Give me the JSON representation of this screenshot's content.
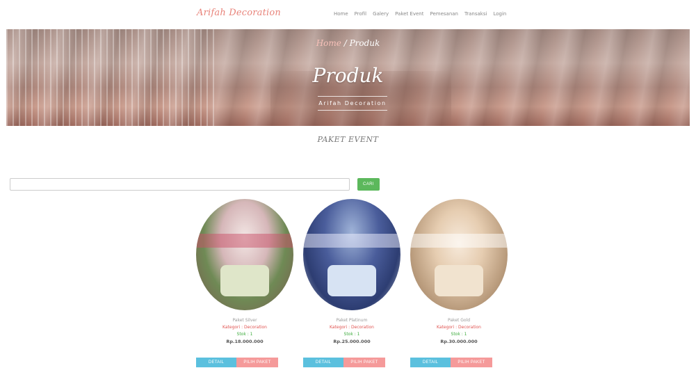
{
  "brand": "Arifah Decoration",
  "nav": [
    "Home",
    "Profil",
    "Galery",
    "Paket Event",
    "Pemesanan",
    "Transaksi",
    "Login"
  ],
  "hero": {
    "breadcrumb_home": "Home",
    "breadcrumb_sep": " / ",
    "breadcrumb_current": "Produk",
    "title": "Produk",
    "subtitle": "Arifah Decoration"
  },
  "section_title": "PAKET EVENT",
  "search": {
    "value": "",
    "placeholder": "",
    "button_label": "CARI"
  },
  "products": [
    {
      "name": "Paket Silver",
      "category": "Kategori : Decoration",
      "stock": "Stok : 1",
      "price": "Rp.18.000.000",
      "detail_label": "DETAIL",
      "choose_label": "PILIH PAKET"
    },
    {
      "name": "Paket Platinum",
      "category": "Kategori : Decoration",
      "stock": "Stok : 1",
      "price": "Rp.25.000.000",
      "detail_label": "DETAIL",
      "choose_label": "PILIH PAKET"
    },
    {
      "name": "Paket Gold",
      "category": "Kategori : Decoration",
      "stock": "Stok : 1",
      "price": "Rp.30.000.000",
      "detail_label": "DETAIL",
      "choose_label": "PILIH PAKET"
    }
  ],
  "colors": {
    "brand": "#e8837a",
    "search_button": "#5cb85c",
    "detail_button": "#5bc0de",
    "choose_button": "#f59a9a",
    "category_text": "#e0524f",
    "stock_text": "#3cab3c"
  }
}
